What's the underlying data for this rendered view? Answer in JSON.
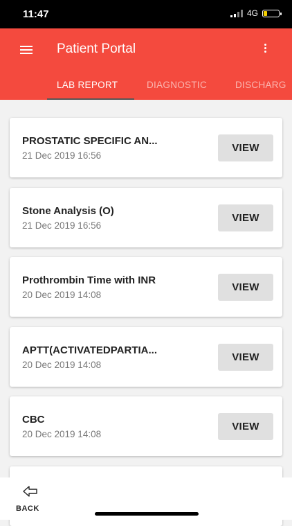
{
  "status": {
    "time": "11:47",
    "network": "4G"
  },
  "header": {
    "title": "Patient Portal",
    "tabs": [
      {
        "label": "LAB REPORT"
      },
      {
        "label": "DIAGNOSTIC"
      },
      {
        "label": "DISCHARG"
      }
    ]
  },
  "reports": [
    {
      "title": "PROSTATIC SPECIFIC AN...",
      "date": "21 Dec 2019 16:56",
      "action": "VIEW"
    },
    {
      "title": "Stone Analysis (O)",
      "date": "21 Dec 2019 16:56",
      "action": "VIEW"
    },
    {
      "title": "Prothrombin Time with INR",
      "date": "20 Dec 2019 14:08",
      "action": "VIEW"
    },
    {
      "title": "APTT(ACTIVATEDPARTIA...",
      "date": "20 Dec 2019 14:08",
      "action": "VIEW"
    },
    {
      "title": "CBC",
      "date": "20 Dec 2019 14:08",
      "action": "VIEW"
    }
  ],
  "footer": {
    "back_label": "BACK"
  },
  "colors": {
    "primary": "#f44a3e",
    "battery": "#f5d000"
  }
}
